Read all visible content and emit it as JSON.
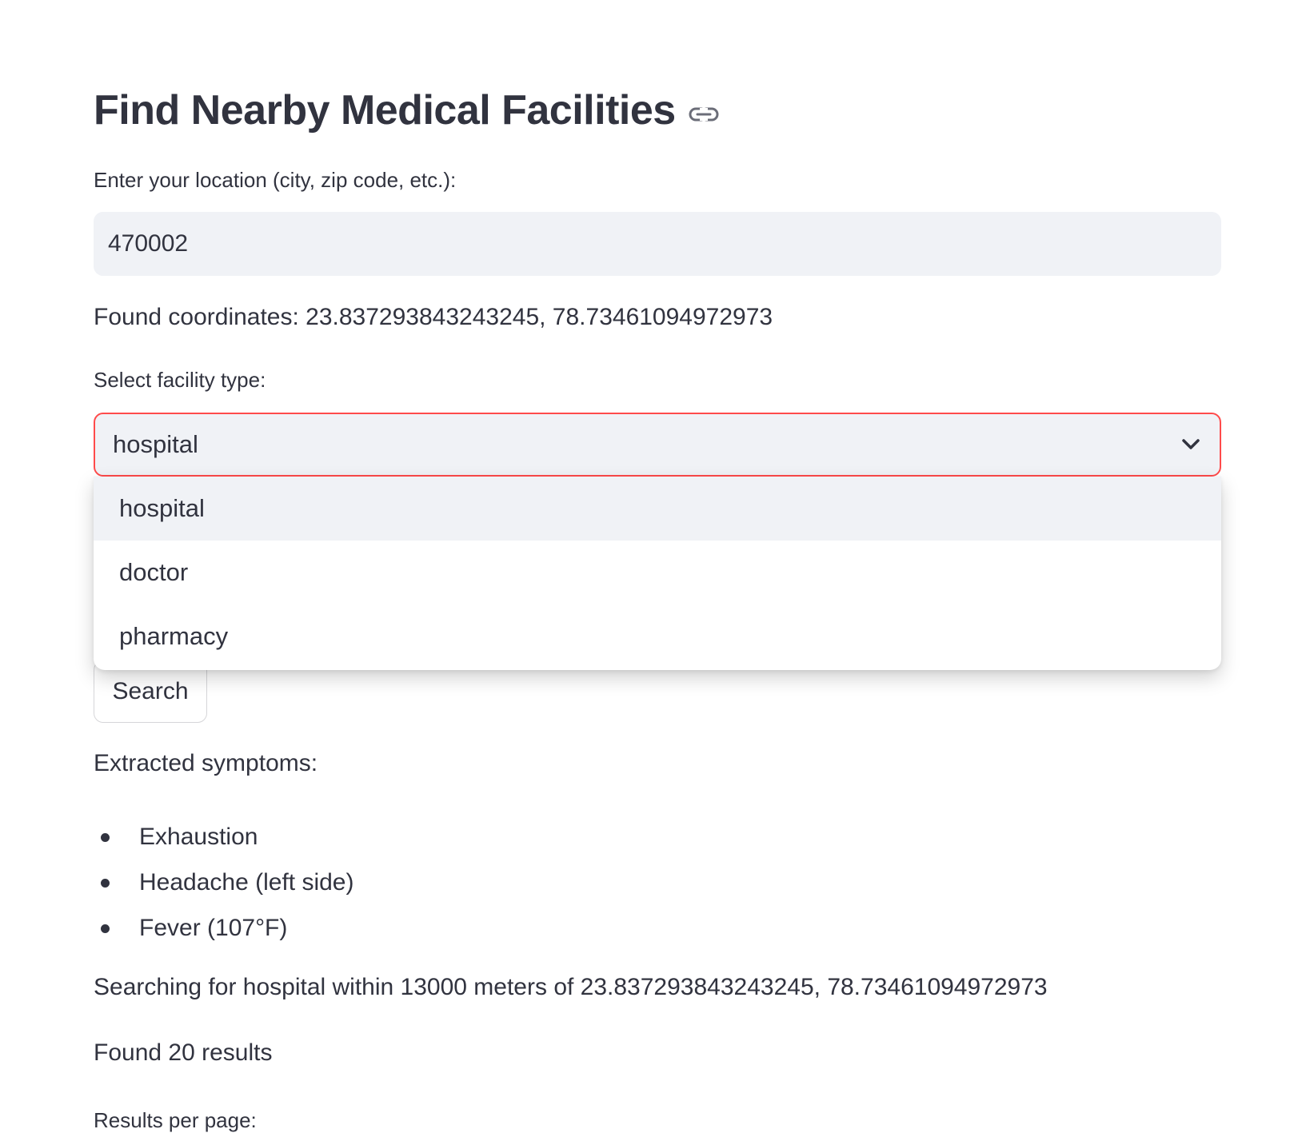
{
  "header": {
    "title": "Find Nearby Medical Facilities",
    "anchor_icon": "link-icon"
  },
  "location": {
    "label": "Enter your location (city, zip code, etc.):",
    "value": "470002"
  },
  "coordinates_text": "Found coordinates: 23.837293843243245, 78.73461094972973",
  "facility": {
    "label": "Select facility type:",
    "selected": "hospital",
    "options": [
      "hospital",
      "doctor",
      "pharmacy"
    ]
  },
  "search_button_label": "Search",
  "symptoms": {
    "heading": "Extracted symptoms:",
    "items": [
      "Exhaustion",
      "Headache (left side)",
      "Fever (107°F)"
    ]
  },
  "search_status": "Searching for hospital within 13000 meters of 23.837293843243245, 78.73461094972973",
  "results_count_text": "Found 20 results",
  "results_per_page_label": "Results per page:",
  "colors": {
    "text": "#31333f",
    "input_bg": "#f0f2f6",
    "focus_border": "#ff4b4b"
  }
}
